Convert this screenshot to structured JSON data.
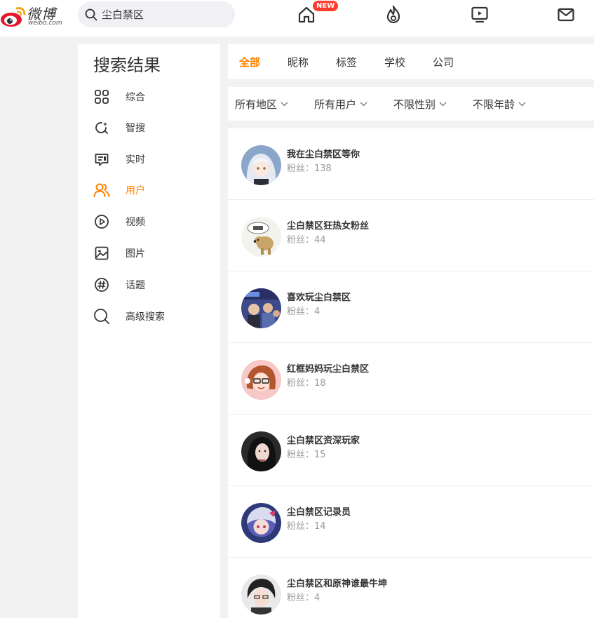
{
  "header": {
    "brand": "微博",
    "domain": "weibo.com",
    "search_value": "尘白禁区",
    "new_badge": "NEW"
  },
  "sidebar": {
    "title": "搜索结果",
    "items": [
      {
        "label": "综合",
        "icon": "grid-icon",
        "active": false
      },
      {
        "label": "智搜",
        "icon": "smart-search-icon",
        "active": false
      },
      {
        "label": "实时",
        "icon": "realtime-icon",
        "active": false
      },
      {
        "label": "用户",
        "icon": "users-icon",
        "active": true
      },
      {
        "label": "视频",
        "icon": "play-icon",
        "active": false
      },
      {
        "label": "图片",
        "icon": "image-icon",
        "active": false
      },
      {
        "label": "话题",
        "icon": "hashtag-icon",
        "active": false
      },
      {
        "label": "高级搜索",
        "icon": "search-icon",
        "active": false
      }
    ]
  },
  "tabs": [
    {
      "label": "全部",
      "active": true
    },
    {
      "label": "昵称",
      "active": false
    },
    {
      "label": "标签",
      "active": false
    },
    {
      "label": "学校",
      "active": false
    },
    {
      "label": "公司",
      "active": false
    }
  ],
  "filters": [
    {
      "label": "所有地区"
    },
    {
      "label": "所有用户"
    },
    {
      "label": "不限性别"
    },
    {
      "label": "不限年龄"
    }
  ],
  "colors": {
    "accent": "#ff8200",
    "badge": "#ff3b30"
  },
  "results": [
    {
      "name": "我在尘白禁区等你",
      "fans": "粉丝：138"
    },
    {
      "name": "尘白禁区狂热女粉丝",
      "fans": "粉丝：44"
    },
    {
      "name": "喜欢玩尘白禁区",
      "fans": "粉丝：4"
    },
    {
      "name": "红框妈妈玩尘白禁区",
      "fans": "粉丝：18"
    },
    {
      "name": "尘白禁区资深玩家",
      "fans": "粉丝：15"
    },
    {
      "name": "尘白禁区记录员",
      "fans": "粉丝：14"
    },
    {
      "name": "尘白禁区和原神谁最牛坤",
      "fans": "粉丝：4"
    }
  ]
}
